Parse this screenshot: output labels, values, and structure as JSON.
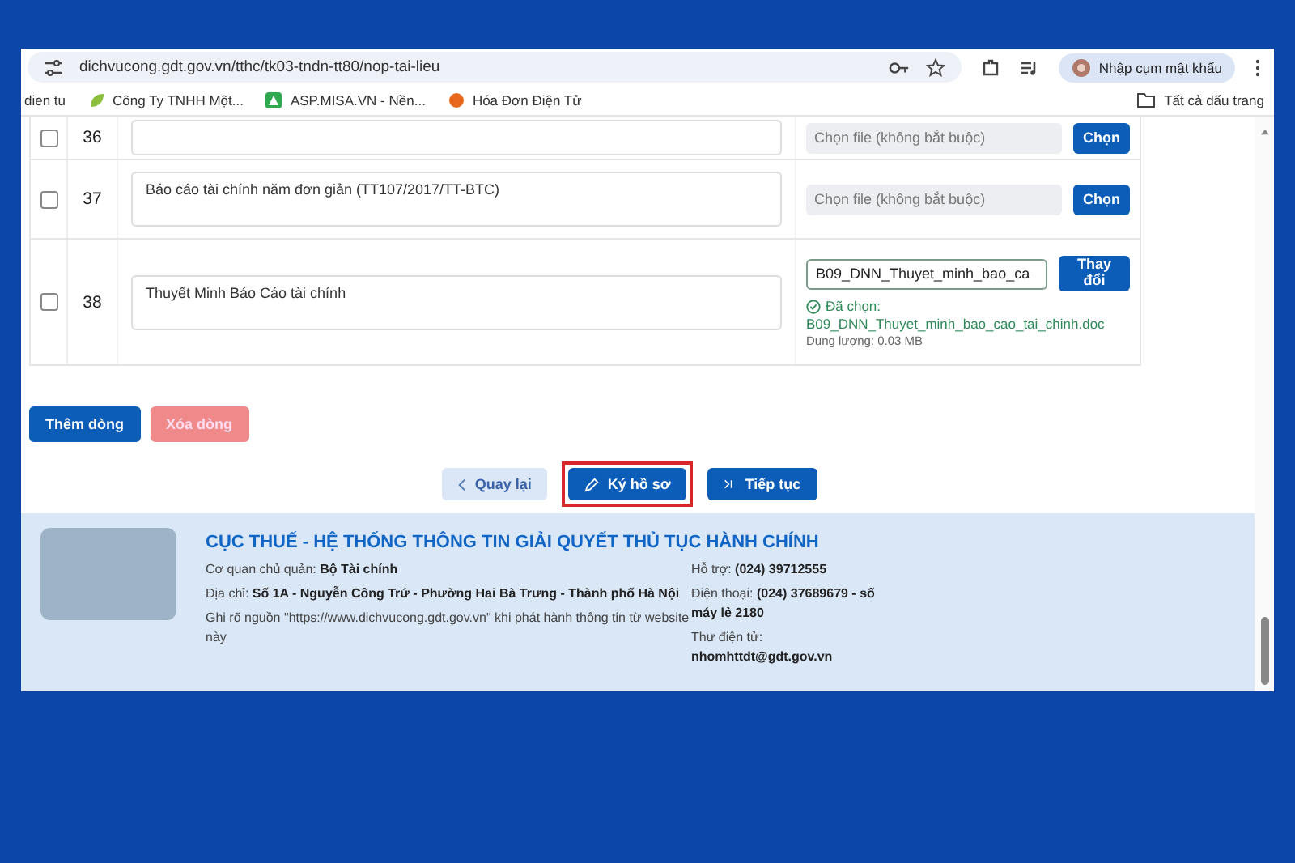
{
  "browser": {
    "url": "dichvucong.gdt.gov.vn/tthc/tk03-tndn-tt80/nop-tai-lieu",
    "profile_label": "Nhập cụm mật khẩu",
    "all_bookmarks": "Tất cả dấu trang",
    "bookmarks": [
      {
        "label": "dien tu",
        "kind": "none"
      },
      {
        "label": "Công Ty TNHH Một...",
        "kind": "leaf"
      },
      {
        "label": "ASP.MISA.VN - Nền...",
        "kind": "misa"
      },
      {
        "label": "Hóa Đơn Điện Tử",
        "kind": "dot"
      }
    ]
  },
  "rows": [
    {
      "number": "36",
      "checked": false,
      "description": "",
      "file": {
        "kind": "empty",
        "placeholder": "Chọn file (không bắt buộc)",
        "button": "Chọn"
      }
    },
    {
      "number": "37",
      "checked": false,
      "description": "Báo cáo tài chính năm đơn giản (TT107/2017/TT-BTC)",
      "file": {
        "kind": "empty",
        "placeholder": "Chọn file (không bắt buộc)",
        "button": "Chọn"
      }
    },
    {
      "number": "38",
      "checked": false,
      "description": "Thuyết Minh Báo Cáo tài chính",
      "file": {
        "kind": "chosen",
        "value": "B09_DNN_Thuyet_minh_bao_ca",
        "button": "Thay đổi",
        "chosen_label": "Đã chọn:",
        "filename": "B09_DNN_Thuyet_minh_bao_cao_tai_chinh.doc",
        "size": "Dung lượng: 0.03 MB"
      }
    }
  ],
  "row_buttons": [
    {
      "label": "Thêm dòng",
      "disabled": false
    },
    {
      "label": "Xóa dòng",
      "disabled": true
    }
  ],
  "nav_buttons": [
    {
      "label": "Quay lại",
      "kind": "back",
      "highlighted": false
    },
    {
      "label": "Ký hồ sơ",
      "kind": "sign",
      "highlighted": true
    },
    {
      "label": "Tiếp tục",
      "kind": "next",
      "highlighted": false
    }
  ],
  "footer": {
    "title": "CỤC THUẾ - HỆ THỐNG THÔNG TIN GIẢI QUYẾT THỦ TỤC HÀNH CHÍNH",
    "left": [
      "Cơ quan chủ quản: **Bộ Tài chính**",
      "Địa chỉ: **Số 1A - Nguyễn Công Trứ - Phường Hai Bà Trưng - Thành phố Hà Nội**",
      "Ghi rõ nguồn \"https://www.dichvucong.gdt.gov.vn\" khi phát hành thông tin từ website này"
    ],
    "right": [
      "Hỗ trợ: **(024) 39712555**",
      "Điện thoại: **(024) 37689679 - số máy lẻ 2180**",
      "Thư điện tử: **nhomhttdt@gdt.gov.vn**"
    ]
  }
}
